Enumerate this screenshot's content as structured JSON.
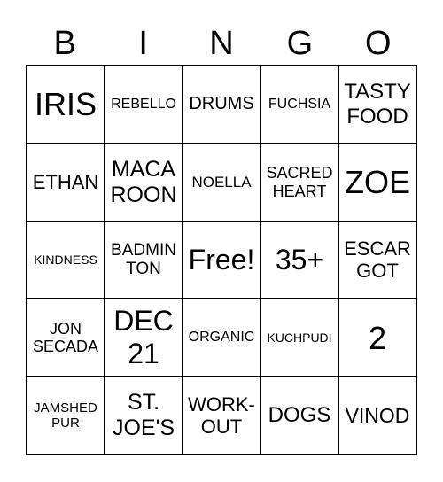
{
  "header": [
    "B",
    "I",
    "N",
    "G",
    "O"
  ],
  "cells": [
    "IRIS",
    "REBELLO",
    "DRUMS",
    "FUCHSIA",
    "TASTY FOOD",
    "ETHAN",
    "MACA ROON",
    "NOELLA",
    "SACRED HEART",
    "ZOE",
    "KINDNESS",
    "BADMIN TON",
    "Free!",
    "35+",
    "ESCAR GOT",
    "JON SECADA",
    "DEC 21",
    "ORGANIC",
    "KUCHPUDI",
    "2",
    "JAMSHED PUR",
    "ST. JOE'S",
    "WORK-OUT",
    "DOGS",
    "VINOD"
  ]
}
